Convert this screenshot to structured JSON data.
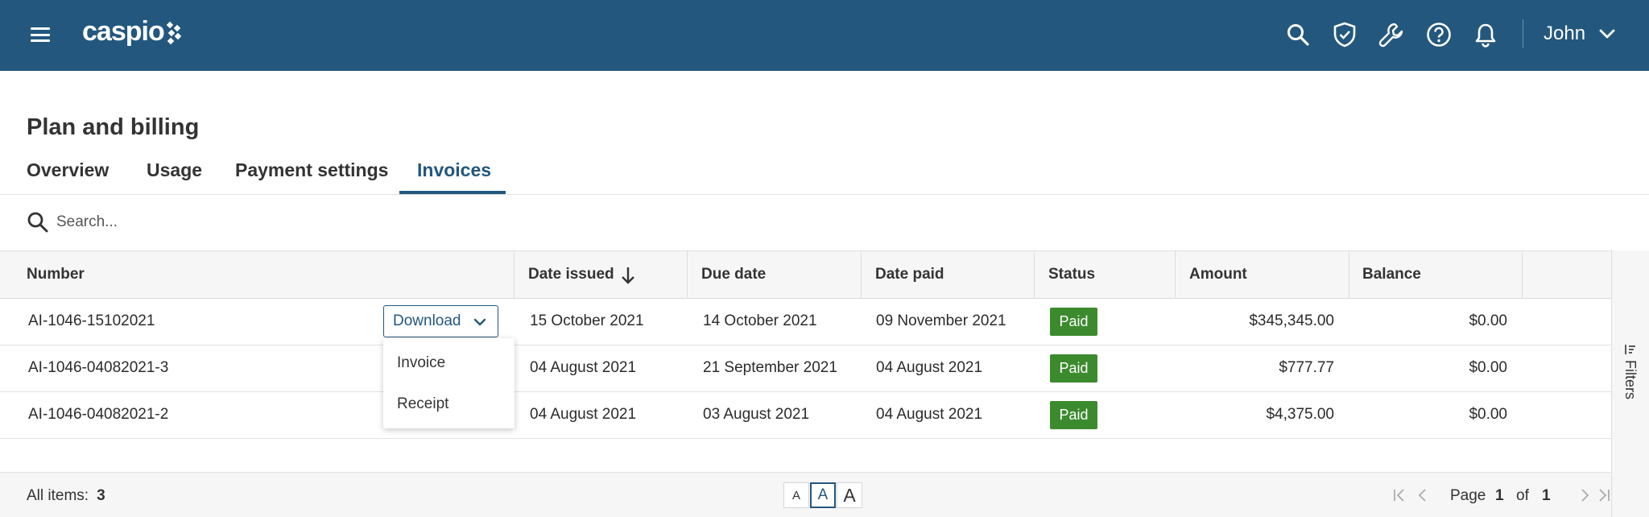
{
  "header": {
    "logo_text": "caspio",
    "user_name": "John",
    "icons": [
      "menu-icon",
      "search-icon",
      "shield-check-icon",
      "wrench-icon",
      "help-icon",
      "bell-icon",
      "chevron-down-icon"
    ],
    "accent_color": "#23577e"
  },
  "page": {
    "title": "Plan and billing",
    "tabs": [
      {
        "label": "Overview",
        "active": false
      },
      {
        "label": "Usage",
        "active": false
      },
      {
        "label": "Payment settings",
        "active": false
      },
      {
        "label": "Invoices",
        "active": true
      }
    ]
  },
  "search": {
    "placeholder": "Search..."
  },
  "table": {
    "columns": [
      "Number",
      "Date issued",
      "Due date",
      "Date paid",
      "Status",
      "Amount",
      "Balance"
    ],
    "sort": {
      "column": "Date issued",
      "direction": "descending"
    },
    "rows": [
      {
        "number": "AI-1046-15102021",
        "date_issued": "15 October 2021",
        "due_date": "14 October 2021",
        "date_paid": "09 November 2021",
        "status": "Paid",
        "amount": "$345,345.00",
        "balance": "$0.00"
      },
      {
        "number": "AI-1046-04082021-3",
        "date_issued": "04 August 2021",
        "due_date": "21 September 2021",
        "date_paid": "04 August 2021",
        "status": "Paid",
        "amount": "$777.77",
        "balance": "$0.00"
      },
      {
        "number": "AI-1046-04082021-2",
        "date_issued": "04 August 2021",
        "due_date": "03 August 2021",
        "date_paid": "04 August 2021",
        "status": "Paid",
        "amount": "$4,375.00",
        "balance": "$0.00"
      }
    ],
    "status_color": "#3c8a2e"
  },
  "download": {
    "label": "Download",
    "options": [
      "Invoice",
      "Receipt"
    ]
  },
  "filters": {
    "label": "Filters"
  },
  "footer": {
    "all_items_label": "All items:",
    "all_items_count": "3",
    "text_sizes": [
      "A",
      "A",
      "A"
    ],
    "active_text_size": "medium",
    "page_label": "Page",
    "page_current": "1",
    "of_label": "of",
    "page_total": "1"
  }
}
